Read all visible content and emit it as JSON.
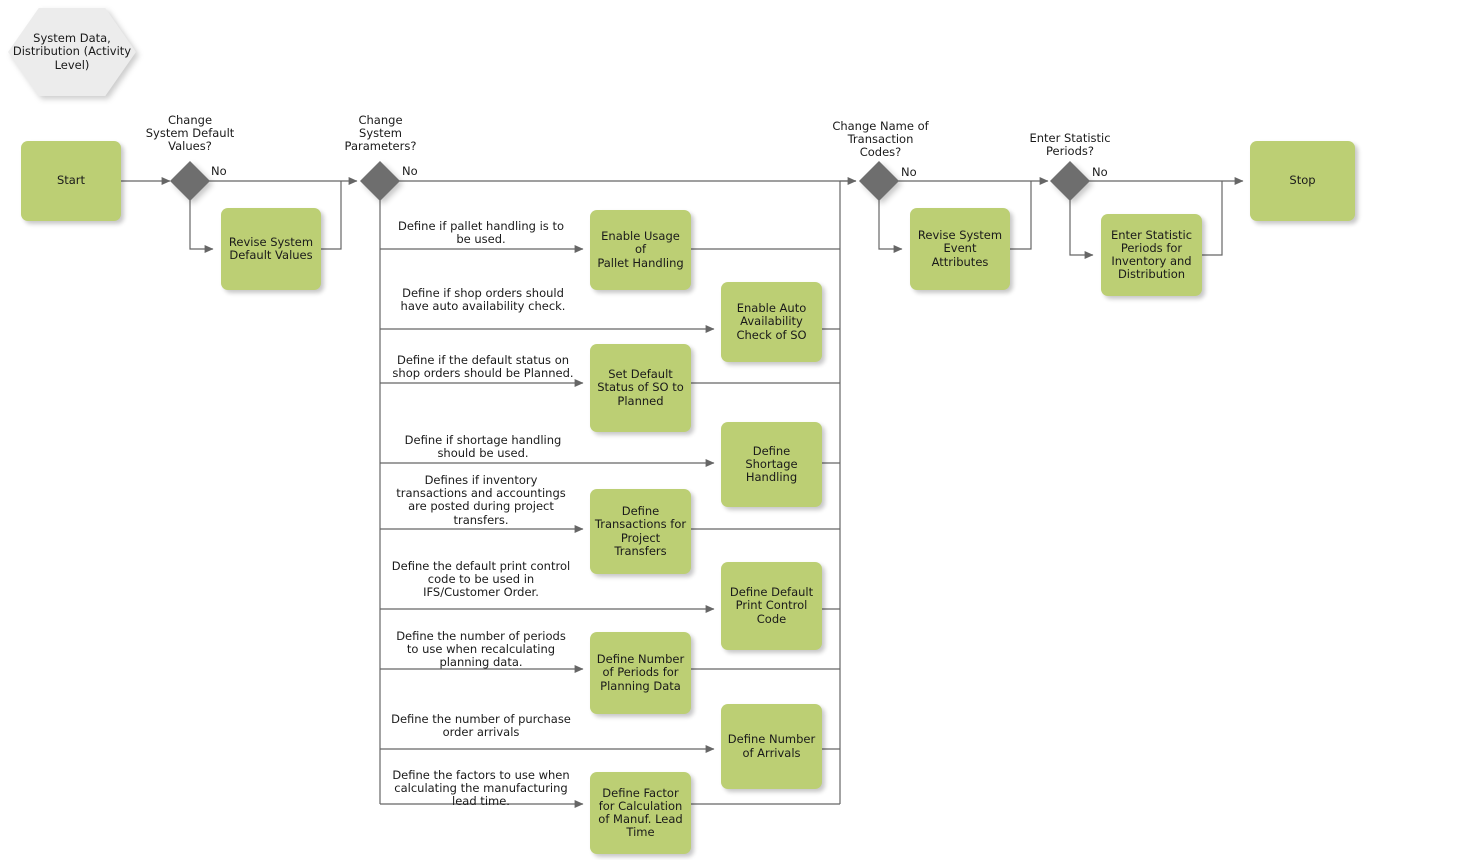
{
  "diagram": {
    "title_node": "System Data,\nDistribution\n(Activity Level)",
    "start_label": "Start",
    "stop_label": "Stop",
    "no_label": "No"
  },
  "decisions": [
    {
      "id": "d1",
      "question": "Change\nSystem Default\nValues?",
      "branch_label": "No"
    },
    {
      "id": "d2",
      "question": "Change\nSystem\nParameters?",
      "branch_label": "No"
    },
    {
      "id": "d3",
      "question": "Change Name of\nTransaction\nCodes?",
      "branch_label": "No"
    },
    {
      "id": "d4",
      "question": "Enter Statistic\nPeriods?",
      "branch_label": "No"
    }
  ],
  "tasks": {
    "revise_defaults": "Revise System\nDefault Values",
    "revise_events": "Revise System\nEvent Attributes",
    "enter_statistic": "Enter Statistic\nPeriods for\nInventory and\nDistribution"
  },
  "parameter_branches": [
    {
      "edge": "Define if pallet handling is to\nbe used.",
      "task": "Enable Usage of\nPallet Handling"
    },
    {
      "edge": "Define if shop orders should\nhave auto availability check.",
      "task": "Enable Auto\nAvailability\nCheck of SO"
    },
    {
      "edge": "Define if the default status on\nshop orders should be Planned.",
      "task": "Set Default\nStatus of SO to\nPlanned"
    },
    {
      "edge": "Define if shortage handling\nshould be used.",
      "task": "Define Shortage\nHandling"
    },
    {
      "edge": "Defines if inventory\ntransactions and accountings\nare posted during project\ntransfers.",
      "task": "Define\nTransactions for\nProject\nTransfers"
    },
    {
      "edge": "Define the default print control\ncode to be used in\nIFS/Customer Order.",
      "task": "Define Default\nPrint Control\nCode"
    },
    {
      "edge": "Define the number of periods\nto use when recalculating\nplanning data.",
      "task": "Define Number\nof Periods for\nPlanning Data"
    },
    {
      "edge": "Define the number of purchase\norder arrivals",
      "task": "Define Number\nof Arrivals"
    },
    {
      "edge": "Define the factors to use when\ncalculating the manufacturing\nlead time.",
      "task": "Define Factor\nfor Calculation\nof Manuf. Lead\nTime"
    }
  ],
  "colors": {
    "task_fill": "#bccf74",
    "decision_fill": "#6e6e6e",
    "title_fill": "#ececec",
    "edge_stroke": "#666666",
    "text": "#1a1a1a"
  }
}
